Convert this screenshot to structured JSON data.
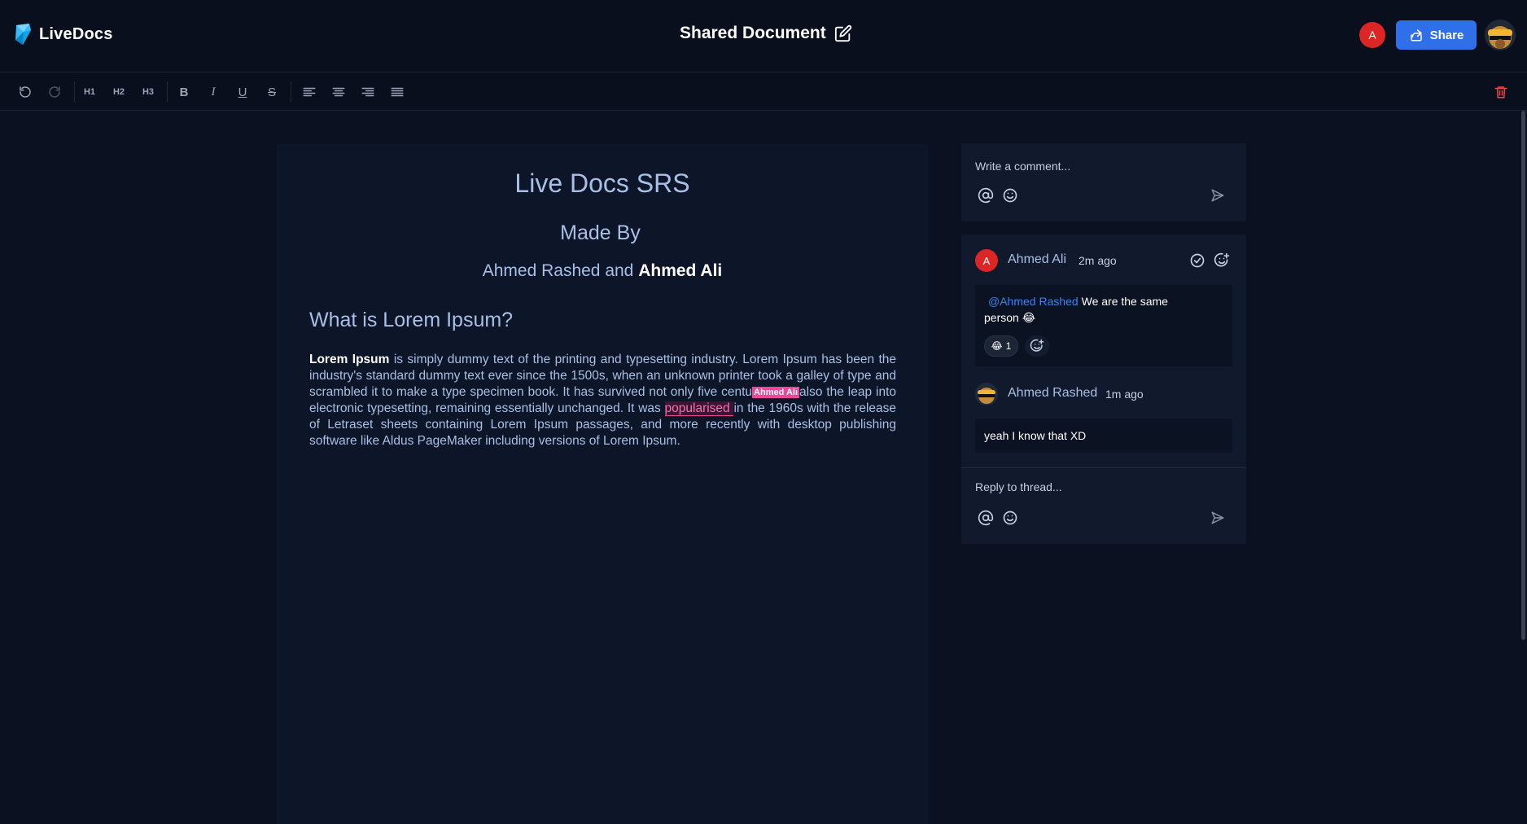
{
  "app": {
    "name": "LiveDocs"
  },
  "header": {
    "document_title": "Shared Document",
    "active_user_initial": "A",
    "share_label": "Share"
  },
  "toolbar": {
    "h1": "H1",
    "h2": "H2",
    "h3": "H3",
    "bold": "B",
    "italic": "I",
    "underline": "U",
    "strike": "S"
  },
  "document": {
    "title": "Live Docs SRS",
    "subtitle": "Made By",
    "authors_plain": "Ahmed Rashed and ",
    "authors_bold": "Ahmed Ali",
    "heading": "What is Lorem Ipsum?",
    "para_bold": "Lorem Ipsum",
    "para_part1": " is simply dummy text of the printing and typesetting industry. Lorem Ipsum has been the industry's standard dummy text ever since the 1500s, when an unknown printer took a galley of type and scrambled it to make a type specimen book. It has survived not only five centu",
    "cursor_label": "Ahmed Ali",
    "para_part2": "also the leap into electronic typesetting, remaining essentially unchanged. It was ",
    "highlight_text": "popularised ",
    "para_part3": "in the 1960s with the release of Letraset sheets containing Lorem Ipsum passages, and more recently with desktop publishing software like Aldus PageMaker including versions of Lorem Ipsum."
  },
  "comments": {
    "new_comment_placeholder": "Write a comment...",
    "thread": [
      {
        "initial": "A",
        "author": "Ahmed Ali",
        "time": "2m ago",
        "mention": "@Ahmed Rashed",
        "text_line1": " We are the same",
        "text_line2": "person 😂",
        "reaction_emoji": "😂",
        "reaction_count": "1"
      },
      {
        "author": "Ahmed Rashed",
        "time": "1m ago",
        "text": "yeah I know that XD"
      }
    ],
    "reply_placeholder": "Reply to thread..."
  },
  "colors": {
    "background": "#0b1120",
    "accent": "#2f6fea",
    "avatar_red": "#dc2626",
    "mention_blue": "#3b82f6",
    "cursor_pink": "#ec4899",
    "text_blue": "#a9bfe6"
  },
  "icons": [
    "logo-icon",
    "edit-icon",
    "share-icon",
    "undo-icon",
    "redo-icon",
    "align-left-icon",
    "align-center-icon",
    "align-right-icon",
    "align-justify-icon",
    "trash-icon",
    "at-icon",
    "emoji-icon",
    "send-icon",
    "resolve-icon",
    "add-reaction-icon"
  ]
}
